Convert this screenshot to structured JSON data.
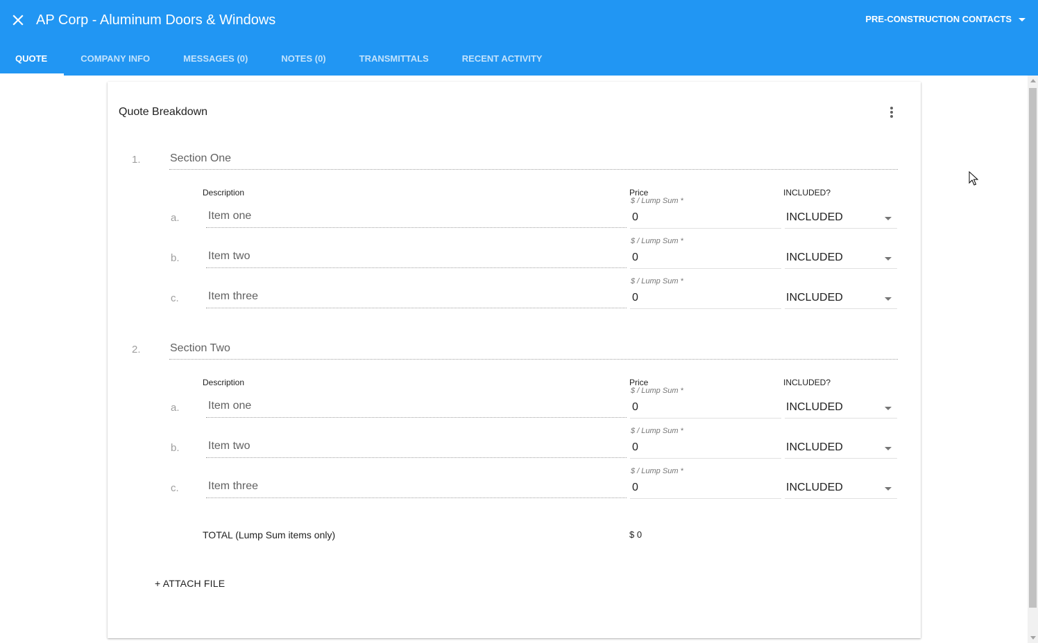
{
  "header": {
    "title": "AP Corp - Aluminum Doors & Windows",
    "contacts_menu": "PRE-CONSTRUCTION CONTACTS"
  },
  "tabs": [
    {
      "label": "QUOTE",
      "active": true
    },
    {
      "label": "COMPANY INFO",
      "active": false
    },
    {
      "label": "MESSAGES (0)",
      "active": false
    },
    {
      "label": "NOTES (0)",
      "active": false
    },
    {
      "label": "TRANSMITTALS",
      "active": false
    },
    {
      "label": "RECENT ACTIVITY",
      "active": false
    }
  ],
  "card": {
    "title": "Quote Breakdown",
    "columns": {
      "description": "Description",
      "price": "Price",
      "price_hint": "$ / Lump Sum *",
      "included": "INCLUDED?"
    },
    "sections": [
      {
        "number": "1.",
        "name": "Section One",
        "items": [
          {
            "letter": "a.",
            "description": "Item one",
            "price": "0",
            "included": "INCLUDED"
          },
          {
            "letter": "b.",
            "description": "Item two",
            "price": "0",
            "included": "INCLUDED"
          },
          {
            "letter": "c.",
            "description": "Item three",
            "price": "0",
            "included": "INCLUDED"
          }
        ]
      },
      {
        "number": "2.",
        "name": "Section Two",
        "items": [
          {
            "letter": "a.",
            "description": "Item one",
            "price": "0",
            "included": "INCLUDED"
          },
          {
            "letter": "b.",
            "description": "Item two",
            "price": "0",
            "included": "INCLUDED"
          },
          {
            "letter": "c.",
            "description": "Item three",
            "price": "0",
            "included": "INCLUDED"
          }
        ]
      }
    ],
    "total_label": "TOTAL (Lump Sum items only)",
    "total_value": "$ 0",
    "attach_label": "+ ATTACH FILE"
  },
  "colors": {
    "app_bar": "#2196f3",
    "tab_text_inactive": "#d0e8fc",
    "text_primary": "#212121",
    "text_muted": "#9e9e9e"
  },
  "icons": {
    "close": "close-icon",
    "menu_caret": "caret-down-icon",
    "card_menu": "more-vert-icon",
    "dropdown": "dropdown-arrow-icon"
  }
}
